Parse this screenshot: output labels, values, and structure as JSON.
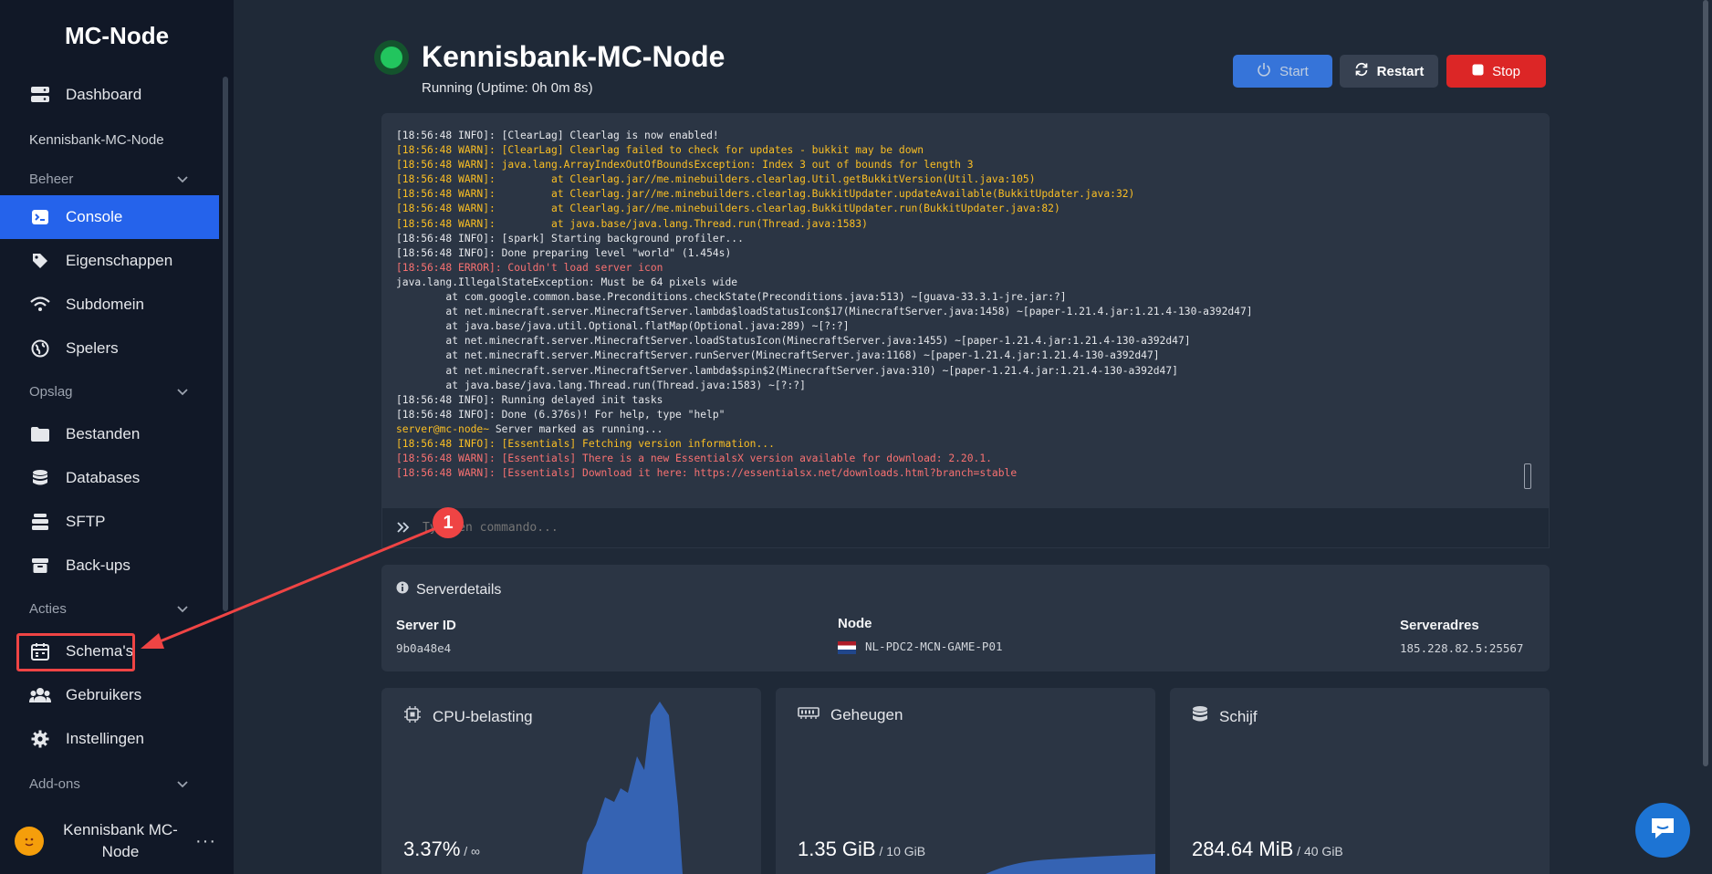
{
  "brand": "MC-Node",
  "sidebar": {
    "dashboard": "Dashboard",
    "server_name": "Kennisbank-MC-Node",
    "section_beheer": "Beheer",
    "console": "Console",
    "eigenschappen": "Eigenschappen",
    "subdomein": "Subdomein",
    "spelers": "Spelers",
    "section_opslag": "Opslag",
    "bestanden": "Bestanden",
    "databases": "Databases",
    "sftp": "SFTP",
    "backups": "Back-ups",
    "section_acties": "Acties",
    "schemas": "Schema's",
    "gebruikers": "Gebruikers",
    "instellingen": "Instellingen",
    "section_addons": "Add-ons",
    "user_name": "Kennisbank MC-Node",
    "more": "···"
  },
  "header": {
    "title": "Kennisbank-MC-Node",
    "status": "Running (Uptime: 0h 0m 8s)",
    "start_label": "Start",
    "restart_label": "Restart",
    "stop_label": "Stop"
  },
  "console": {
    "lines": [
      {
        "type": "plain",
        "text": "[18:56:48 INFO]: [ClearLag] Clearlag is now enabled!"
      },
      {
        "type": "warn",
        "text": "[18:56:48 WARN]: [ClearLag] Clearlag failed to check for updates - bukkit may be down"
      },
      {
        "type": "warn",
        "text": "[18:56:48 WARN]: java.lang.ArrayIndexOutOfBoundsException: Index 3 out of bounds for length 3"
      },
      {
        "type": "warn",
        "text": "[18:56:48 WARN]:         at Clearlag.jar//me.minebuilders.clearlag.Util.getBukkitVersion(Util.java:105)"
      },
      {
        "type": "warn",
        "text": "[18:56:48 WARN]:         at Clearlag.jar//me.minebuilders.clearlag.BukkitUpdater.updateAvailable(BukkitUpdater.java:32)"
      },
      {
        "type": "warn",
        "text": "[18:56:48 WARN]:         at Clearlag.jar//me.minebuilders.clearlag.BukkitUpdater.run(BukkitUpdater.java:82)"
      },
      {
        "type": "warn",
        "text": "[18:56:48 WARN]:         at java.base/java.lang.Thread.run(Thread.java:1583)"
      },
      {
        "type": "plain",
        "text": "[18:56:48 INFO]: [spark] Starting background profiler..."
      },
      {
        "type": "plain",
        "text": "[18:56:48 INFO]: Done preparing level \"world\" (1.454s)"
      },
      {
        "type": "error",
        "text": "[18:56:48 ERROR]: Couldn't load server icon"
      },
      {
        "type": "plain",
        "text": "java.lang.IllegalStateException: Must be 64 pixels wide"
      },
      {
        "type": "plain",
        "text": "        at com.google.common.base.Preconditions.checkState(Preconditions.java:513) ~[guava-33.3.1-jre.jar:?]"
      },
      {
        "type": "plain",
        "text": "        at net.minecraft.server.MinecraftServer.lambda$loadStatusIcon$17(MinecraftServer.java:1458) ~[paper-1.21.4.jar:1.21.4-130-a392d47]"
      },
      {
        "type": "plain",
        "text": "        at java.base/java.util.Optional.flatMap(Optional.java:289) ~[?:?]"
      },
      {
        "type": "plain",
        "text": "        at net.minecraft.server.MinecraftServer.loadStatusIcon(MinecraftServer.java:1455) ~[paper-1.21.4.jar:1.21.4-130-a392d47]"
      },
      {
        "type": "plain",
        "text": "        at net.minecraft.server.MinecraftServer.runServer(MinecraftServer.java:1168) ~[paper-1.21.4.jar:1.21.4-130-a392d47]"
      },
      {
        "type": "plain",
        "text": "        at net.minecraft.server.MinecraftServer.lambda$spin$2(MinecraftServer.java:310) ~[paper-1.21.4.jar:1.21.4-130-a392d47]"
      },
      {
        "type": "plain",
        "text": "        at java.base/java.lang.Thread.run(Thread.java:1583) ~[?:?]"
      },
      {
        "type": "plain",
        "text": "[18:56:48 INFO]: Running delayed init tasks"
      },
      {
        "type": "plain",
        "text": "[18:56:48 INFO]: Done (6.376s)! For help, type \"help\""
      },
      {
        "type": "prompt",
        "text": "server@mc-node~ Server marked as running..."
      },
      {
        "type": "warn",
        "text": "[18:56:48 INFO]: [Essentials] Fetching version information..."
      },
      {
        "type": "error",
        "text": "[18:56:48 WARN]: [Essentials] There is a new EssentialsX version available for download: 2.20.1."
      },
      {
        "type": "error",
        "text": "[18:56:48 WARN]: [Essentials] Download it here: https://essentialsx.net/downloads.html?branch=stable"
      }
    ],
    "input_placeholder": "Typ een commando..."
  },
  "details": {
    "title": "Serverdetails",
    "server_id_label": "Server ID",
    "server_id": "9b0a48e4",
    "node_label": "Node",
    "node": "NL-PDC2-MCN-GAME-P01",
    "address_label": "Serveradres",
    "address": "185.228.82.5:25567"
  },
  "stats": {
    "cpu": {
      "title": "CPU-belasting",
      "value": "3.37%",
      "limit": " / ∞"
    },
    "memory": {
      "title": "Geheugen",
      "value": "1.35 GiB",
      "limit": " / 10 GiB"
    },
    "disk": {
      "title": "Schijf",
      "value": "284.64 MiB",
      "limit": " / 40 GiB"
    }
  },
  "annotation": {
    "badge": "1"
  },
  "colors": {
    "accent": "#2563eb",
    "running": "#22c55e",
    "stop": "#dc2626",
    "graph": "#3563b3"
  }
}
